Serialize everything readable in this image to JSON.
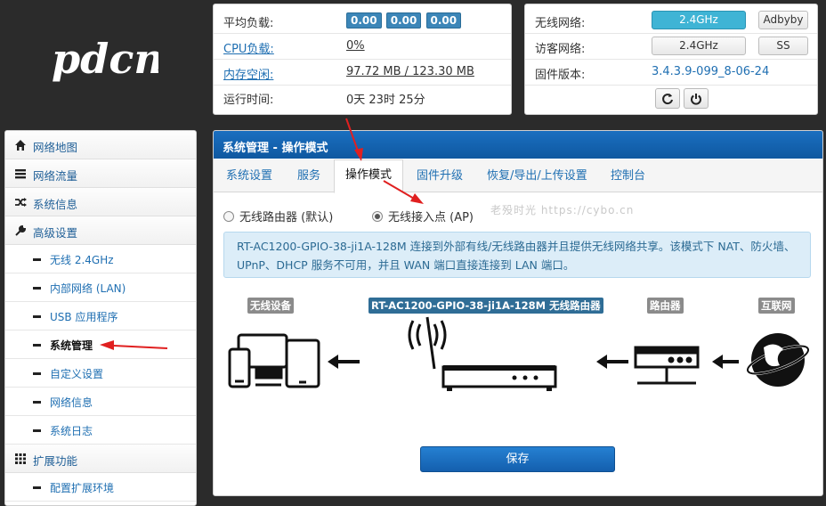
{
  "logo": {
    "text": "pdcn"
  },
  "status_left": {
    "rows": [
      {
        "key": "平均负载:",
        "is_link": false,
        "loads": [
          "0.00",
          "0.00",
          "0.00"
        ]
      },
      {
        "key": "CPU负载:",
        "is_link": true,
        "value": "0%"
      },
      {
        "key": "内存空闲:",
        "is_link": true,
        "value": "97.72 MB / 123.30 MB"
      },
      {
        "key": "运行时间:",
        "is_link": false,
        "value": "0天 23时 25分"
      }
    ]
  },
  "status_right": {
    "wireless_label": "无线网络:",
    "wireless_band": "2.4GHz",
    "wireless_ssid": "Adbyby",
    "guest_label": "访客网络:",
    "guest_band": "2.4GHz",
    "guest_ssid": "SS",
    "firmware_label": "固件版本:",
    "firmware_value": "3.4.3.9-099_8-06-24",
    "refresh_icon": "refresh-icon",
    "power_icon": "power-icon"
  },
  "sidebar": {
    "items": [
      {
        "type": "nav",
        "label": "网络地图",
        "icon": "home-icon"
      },
      {
        "type": "nav",
        "label": "网络流量",
        "icon": "list-icon"
      },
      {
        "type": "nav",
        "label": "系统信息",
        "icon": "shuffle-icon"
      },
      {
        "type": "nav",
        "label": "高级设置",
        "icon": "wrench-icon"
      },
      {
        "type": "sub",
        "label": "无线 2.4GHz"
      },
      {
        "type": "sub",
        "label": "内部网络 (LAN)"
      },
      {
        "type": "sub",
        "label": "USB 应用程序"
      },
      {
        "type": "sub",
        "label": "系统管理",
        "active": true
      },
      {
        "type": "sub",
        "label": "自定义设置"
      },
      {
        "type": "sub",
        "label": "网络信息"
      },
      {
        "type": "sub",
        "label": "系统日志"
      },
      {
        "type": "nav",
        "label": "扩展功能",
        "icon": "grid-icon"
      },
      {
        "type": "sub",
        "label": "配置扩展环境"
      }
    ]
  },
  "main": {
    "header": "系统管理 - 操作模式",
    "tabs": [
      "系统设置",
      "服务",
      "操作模式",
      "固件升级",
      "恢复/导出/上传设置",
      "控制台"
    ],
    "active_tab": "操作模式",
    "mode_router": "无线路由器 (默认)",
    "mode_ap": "无线接入点 (AP)",
    "selected_mode": "无线接入点 (AP)",
    "watermark": "老殁时光 https://cybo.cn",
    "info_text": "RT-AC1200-GPIO-38-ji1A-128M 连接到外部有线/无线路由器并且提供无线网络共享。该模式下 NAT、防火墙、UPnP、DHCP 服务不可用，并且 WAN 端口直接连接到 LAN 端口。",
    "diagram": {
      "cap_devices": "无线设备",
      "cap_router_ap": "RT-AC1200-GPIO-38-ji1A-128M 无线路由器",
      "cap_router": "路由器",
      "cap_internet": "互联网"
    },
    "save_label": "保存"
  },
  "colors": {
    "accent": "#1a6fc0",
    "badge": "#3c86b8",
    "active_band": "#3fb4d5",
    "annotation_arrow": "#e02020"
  }
}
